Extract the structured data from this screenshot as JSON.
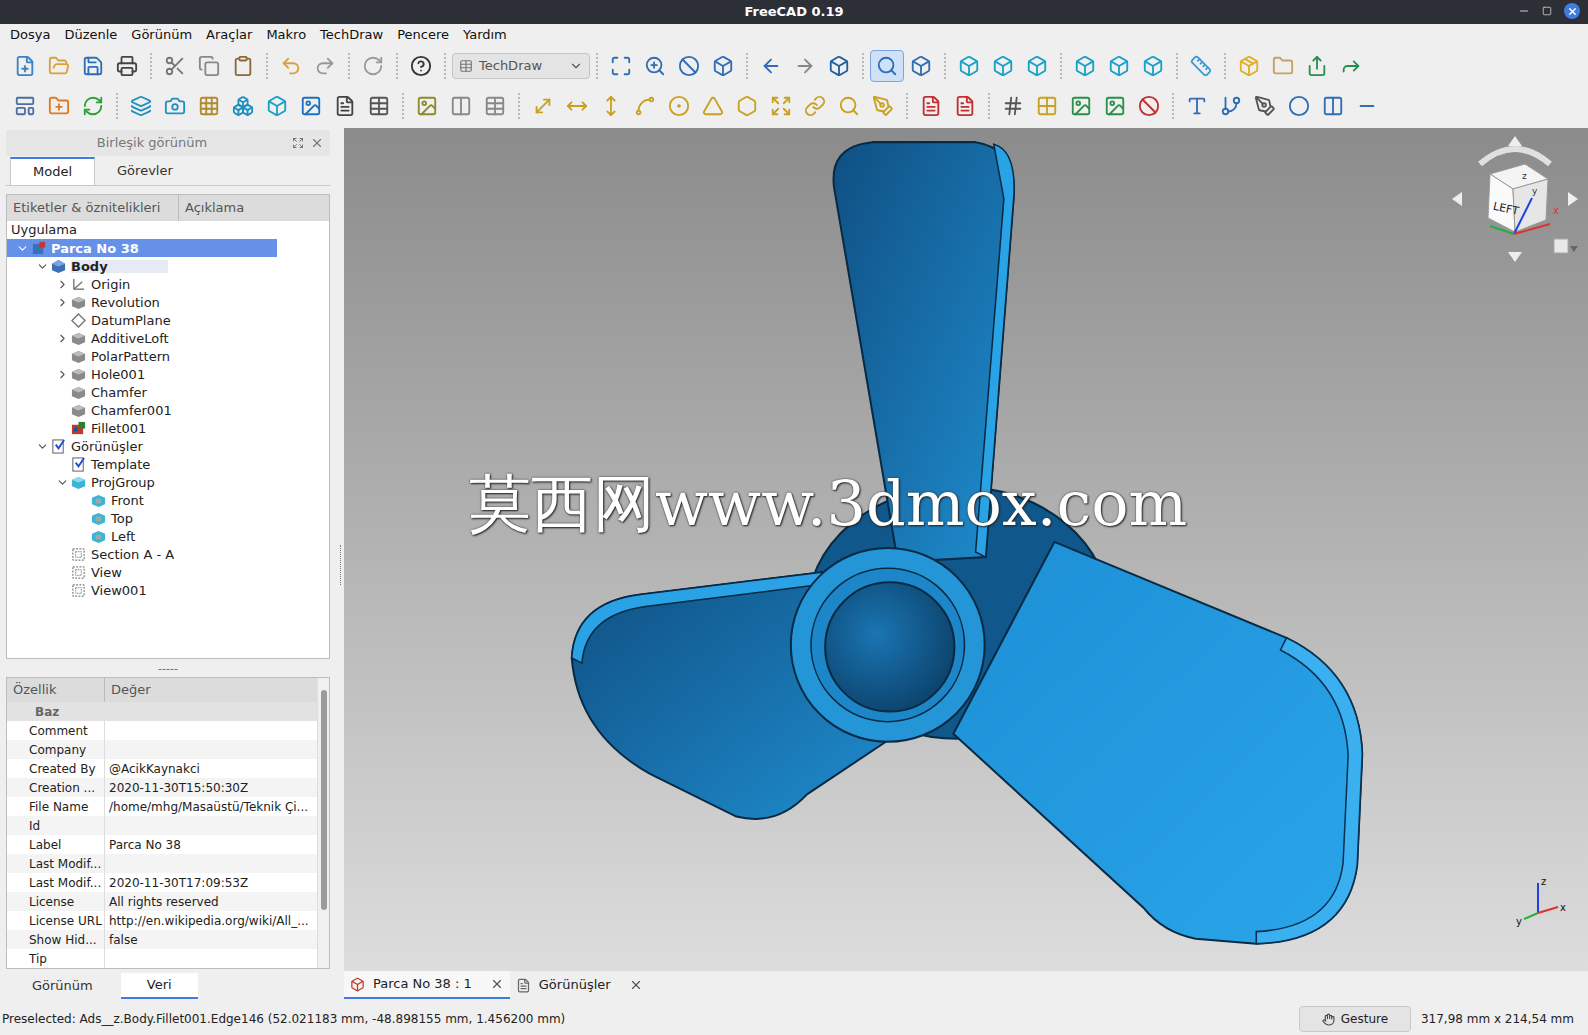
{
  "window": {
    "title": "FreeCAD 0.19"
  },
  "menu": [
    "Dosya",
    "Düzenle",
    "Görünüm",
    "Araçlar",
    "Makro",
    "TechDraw",
    "Pencere",
    "Yardım"
  ],
  "toolbar": {
    "workbench": "TechDraw",
    "box_zoom_active": true
  },
  "combo_view": {
    "title": "Birleşik görünüm",
    "tabs": [
      {
        "label": "Model",
        "selected": true
      },
      {
        "label": "Görevler",
        "selected": false
      }
    ]
  },
  "tree": {
    "columns": [
      "Etiketler & öznitelikleri",
      "Açıklama"
    ],
    "root": "Uygulama",
    "items": [
      {
        "label": "Parca No 38",
        "level": 0,
        "kind": "document",
        "expandable": true,
        "expanded": true,
        "selected": true,
        "bold": true,
        "active": false
      },
      {
        "label": "Body",
        "level": 1,
        "kind": "body",
        "expandable": true,
        "expanded": true,
        "selected": false,
        "bold": true,
        "active": true
      },
      {
        "label": "Origin",
        "level": 2,
        "kind": "origin",
        "expandable": true,
        "expanded": false,
        "selected": false,
        "bold": false,
        "active": false
      },
      {
        "label": "Revolution",
        "level": 2,
        "kind": "feature",
        "expandable": true,
        "expanded": false,
        "selected": false,
        "bold": false,
        "active": false
      },
      {
        "label": "DatumPlane",
        "level": 2,
        "kind": "datum",
        "expandable": false,
        "expanded": false,
        "selected": false,
        "bold": false,
        "active": false
      },
      {
        "label": "AdditiveLoft",
        "level": 2,
        "kind": "feature",
        "expandable": true,
        "expanded": false,
        "selected": false,
        "bold": false,
        "active": false
      },
      {
        "label": "PolarPattern",
        "level": 2,
        "kind": "feature",
        "expandable": false,
        "expanded": false,
        "selected": false,
        "bold": false,
        "active": false
      },
      {
        "label": "Hole001",
        "level": 2,
        "kind": "feature",
        "expandable": true,
        "expanded": false,
        "selected": false,
        "bold": false,
        "active": false
      },
      {
        "label": "Chamfer",
        "level": 2,
        "kind": "feature",
        "expandable": false,
        "expanded": false,
        "selected": false,
        "bold": false,
        "active": false
      },
      {
        "label": "Chamfer001",
        "level": 2,
        "kind": "feature",
        "expandable": false,
        "expanded": false,
        "selected": false,
        "bold": false,
        "active": false
      },
      {
        "label": "Fillet001",
        "level": 2,
        "kind": "fillet",
        "expandable": false,
        "expanded": false,
        "selected": false,
        "bold": false,
        "active": false
      },
      {
        "label": "Görünüşler",
        "level": 1,
        "kind": "page",
        "expandable": true,
        "expanded": true,
        "selected": false,
        "bold": false,
        "active": false
      },
      {
        "label": "Template",
        "level": 2,
        "kind": "page",
        "expandable": false,
        "expanded": false,
        "selected": false,
        "bold": false,
        "active": false
      },
      {
        "label": "ProjGroup",
        "level": 2,
        "kind": "projgroup",
        "expandable": true,
        "expanded": true,
        "selected": false,
        "bold": false,
        "active": false
      },
      {
        "label": "Front",
        "level": 3,
        "kind": "view",
        "expandable": false,
        "expanded": false,
        "selected": false,
        "bold": false,
        "active": false
      },
      {
        "label": "Top",
        "level": 3,
        "kind": "view",
        "expandable": false,
        "expanded": false,
        "selected": false,
        "bold": false,
        "active": false
      },
      {
        "label": "Left",
        "level": 3,
        "kind": "view",
        "expandable": false,
        "expanded": false,
        "selected": false,
        "bold": false,
        "active": false
      },
      {
        "label": "Section A - A",
        "level": 2,
        "kind": "section",
        "expandable": false,
        "expanded": false,
        "selected": false,
        "bold": false,
        "active": false
      },
      {
        "label": "View",
        "level": 2,
        "kind": "section",
        "expandable": false,
        "expanded": false,
        "selected": false,
        "bold": false,
        "active": false
      },
      {
        "label": "View001",
        "level": 2,
        "kind": "section",
        "expandable": false,
        "expanded": false,
        "selected": false,
        "bold": false,
        "active": false
      }
    ]
  },
  "splitter": "-----",
  "properties": {
    "columns": [
      "Özellik",
      "Değer"
    ],
    "group": "Baz",
    "rows": [
      {
        "name": "Comment",
        "value": ""
      },
      {
        "name": "Company",
        "value": ""
      },
      {
        "name": "Created By",
        "value": "@AcikKaynakci"
      },
      {
        "name": "Creation ...",
        "value": "2020-11-30T15:50:30Z"
      },
      {
        "name": "File Name",
        "value": "/home/mhg/Masaüstü/Teknik Çi..."
      },
      {
        "name": "Id",
        "value": ""
      },
      {
        "name": "Label",
        "value": "Parca No 38"
      },
      {
        "name": "Last Modif...",
        "value": ""
      },
      {
        "name": "Last Modif...",
        "value": "2020-11-30T17:09:53Z"
      },
      {
        "name": "License",
        "value": "All rights reserved"
      },
      {
        "name": "License URL",
        "value": "http://en.wikipedia.org/wiki/All_..."
      },
      {
        "name": "Show Hid...",
        "value": "false"
      },
      {
        "name": "Tip",
        "value": ""
      }
    ]
  },
  "property_tabs": [
    {
      "label": "Görünüm",
      "selected": false
    },
    {
      "label": "Veri",
      "selected": true
    }
  ],
  "viewport": {
    "watermark": "莫西网www.3dmox.com",
    "nav_cube": {
      "face": "LEFT",
      "axes": [
        "z",
        "x",
        "y"
      ]
    },
    "axis_labels": [
      "z",
      "y",
      "x"
    ]
  },
  "document_tabs": [
    {
      "label": "Parca No 38 : 1",
      "selected": true,
      "kind": "model"
    },
    {
      "label": "Görünüşler",
      "selected": false,
      "kind": "page"
    }
  ],
  "status_bar": {
    "message": "Preselected: Ads__z.Body.Fillet001.Edge146 (52.021183 mm, -48.898155 mm, 1.456200 mm)",
    "navigation": "Gesture",
    "size": "317,98 mm x 214,54 mm"
  }
}
